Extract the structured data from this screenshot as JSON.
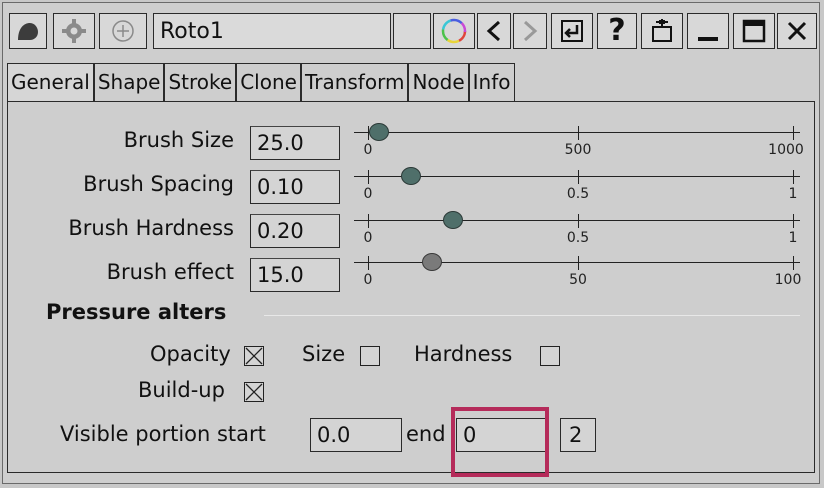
{
  "window": {
    "title": "Roto1",
    "buttons": [
      "menu-icon",
      "gear-icon",
      "add-icon",
      "title-field",
      "blank-button",
      "color-wheel-icon",
      "back-icon",
      "forward-icon",
      "pin-icon",
      "help-icon",
      "float-icon",
      "minimize-icon",
      "maximize-icon",
      "close-icon"
    ]
  },
  "tabs": [
    {
      "label": "General"
    },
    {
      "label": "Shape"
    },
    {
      "label": "Stroke"
    },
    {
      "label": "Clone"
    },
    {
      "label": "Transform"
    },
    {
      "label": "Node"
    },
    {
      "label": "Info"
    }
  ],
  "sliders": [
    {
      "label": "Brush Size",
      "value": "25.0",
      "ticks": [
        "0",
        "500",
        "1000"
      ],
      "min": 0,
      "max": 1000,
      "position": 25,
      "handle_color": "#4f6f6a"
    },
    {
      "label": "Brush Spacing",
      "value": "0.10",
      "ticks": [
        "0",
        "0.5",
        "1"
      ],
      "min": 0,
      "max": 1,
      "position": 0.1,
      "handle_color": "#4f6f6a"
    },
    {
      "label": "Brush Hardness",
      "value": "0.20",
      "ticks": [
        "0",
        "0.5",
        "1"
      ],
      "min": 0,
      "max": 1,
      "position": 0.2,
      "handle_color": "#4f6f6a"
    },
    {
      "label": "Brush effect",
      "value": "15.0",
      "ticks": [
        "0",
        "50",
        "100"
      ],
      "min": 0,
      "max": 100,
      "position": 15,
      "handle_color": "#7a7a7a"
    }
  ],
  "pressure": {
    "title": "Pressure alters",
    "opacity_label": "Opacity",
    "opacity_checked": true,
    "size_label": "Size",
    "size_checked": false,
    "hardness_label": "Hardness",
    "hardness_checked": false,
    "buildup_label": "Build-up",
    "buildup_checked": true
  },
  "visible_portion": {
    "label": "Visible portion start",
    "start_value": "0.0",
    "end_label": "end",
    "end_value": "0",
    "extra_value": "2"
  },
  "colors": {
    "highlight": "#b52b5a",
    "handle": "#4f6f6a"
  }
}
